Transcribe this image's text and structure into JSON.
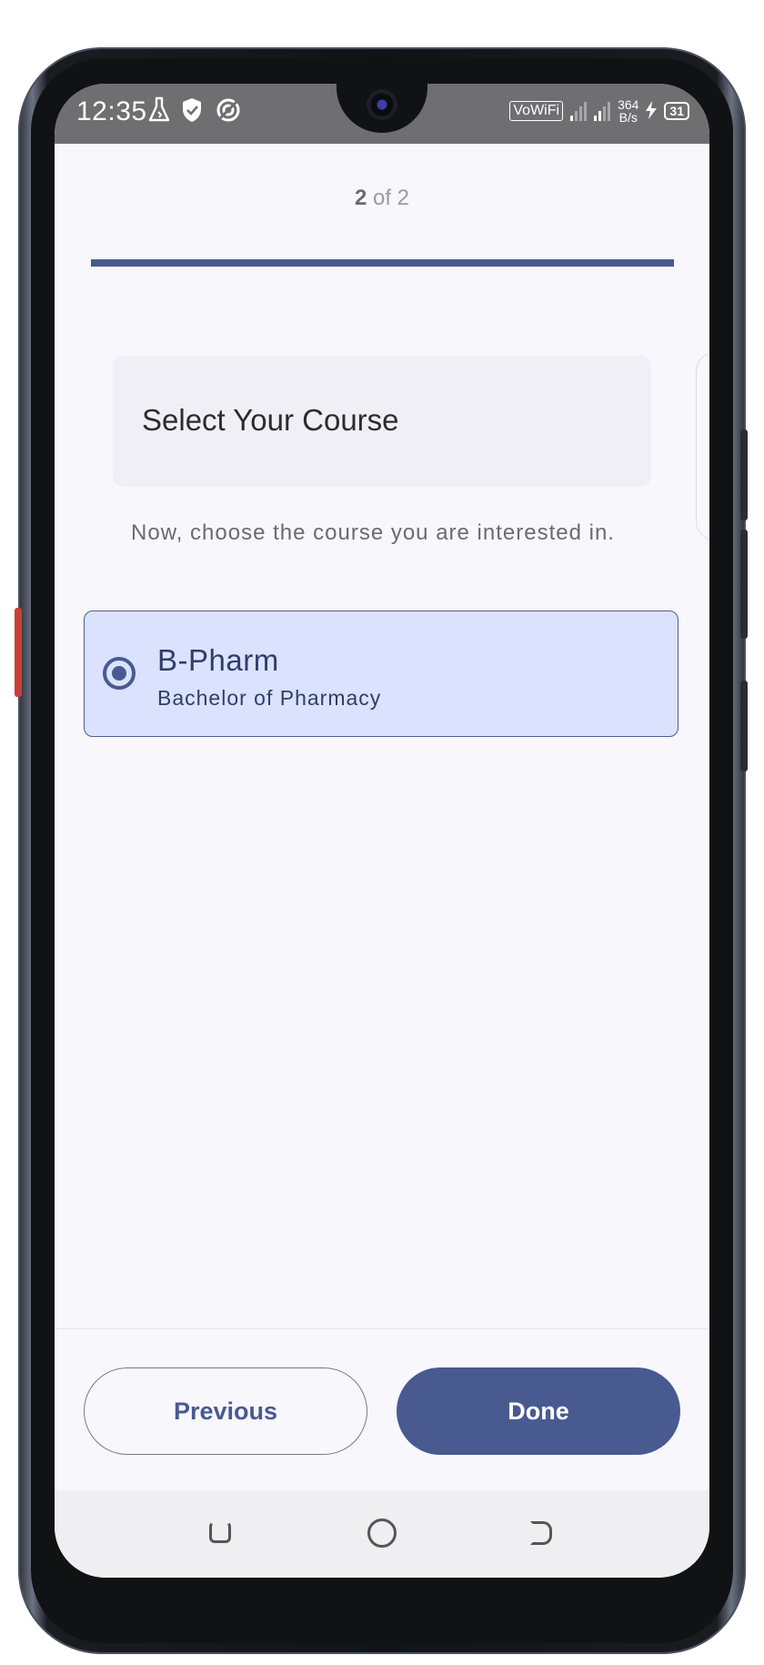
{
  "status_bar": {
    "time": "12:35",
    "icons": [
      "lab-flask-icon",
      "shield-check-icon",
      "data-saver-icon"
    ],
    "vowifi": "VoWiFi",
    "speed_value": "364",
    "speed_unit": "B/s",
    "battery": "31"
  },
  "stepper": {
    "current": "2",
    "separator_total": "of 2",
    "progress_fraction": 1.0
  },
  "title_card": {
    "title": "Select Your Course"
  },
  "subtitle": "Now, choose the course you are interested in.",
  "options": [
    {
      "title": "B-Pharm",
      "subtitle": "Bachelor of Pharmacy",
      "selected": true
    }
  ],
  "footer": {
    "previous_label": "Previous",
    "done_label": "Done"
  },
  "colors": {
    "accent": "#485a90",
    "selected_card_bg": "#dae2fe",
    "screen_bg": "#f7f7fc"
  },
  "navigation_bar": {
    "icons": [
      "recent-apps-icon",
      "home-icon",
      "back-icon"
    ]
  }
}
